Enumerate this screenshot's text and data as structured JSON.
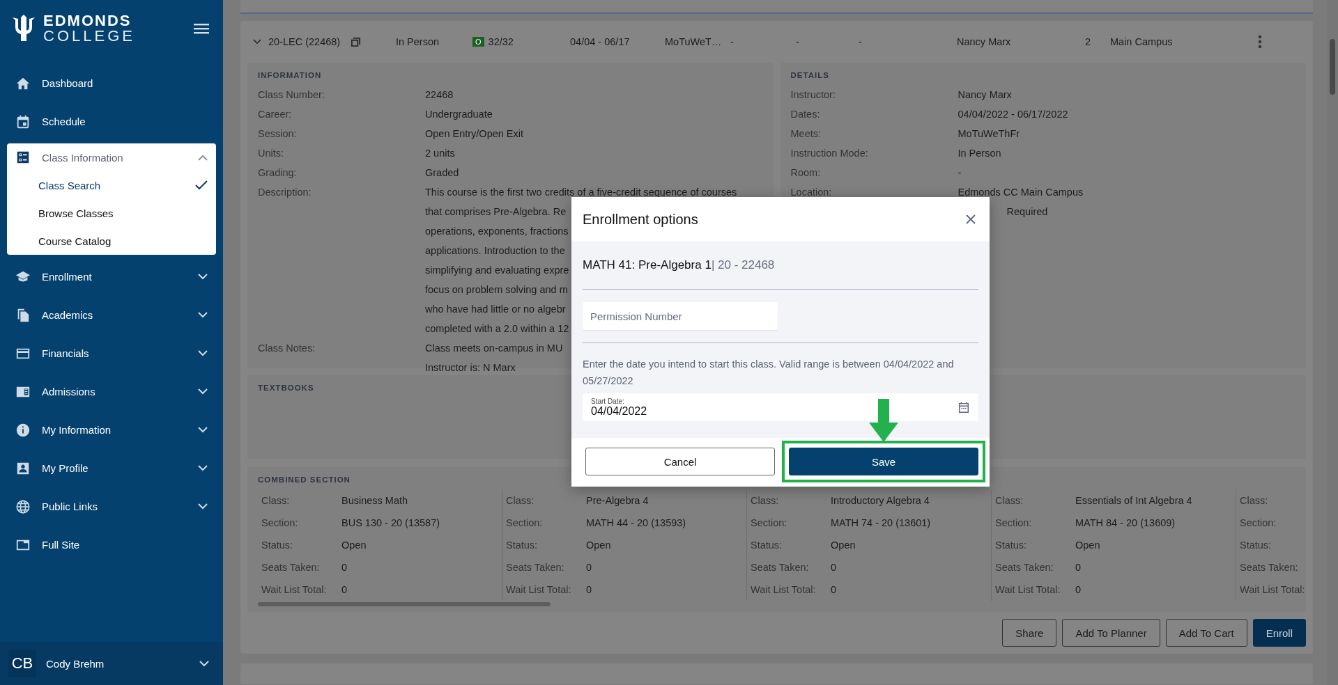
{
  "sidebar": {
    "logo": {
      "line1": "EDMONDS",
      "line2": "COLLEGE"
    },
    "items": [
      {
        "label": "Dashboard",
        "expandable": false,
        "expanded": false
      },
      {
        "label": "Schedule",
        "expandable": false,
        "expanded": false
      },
      {
        "label": "Class Information",
        "expandable": true,
        "expanded": true,
        "children": [
          {
            "label": "Class Search",
            "selected": true
          },
          {
            "label": "Browse Classes",
            "selected": false
          },
          {
            "label": "Course Catalog",
            "selected": false
          }
        ]
      },
      {
        "label": "Enrollment",
        "expandable": true,
        "expanded": false
      },
      {
        "label": "Academics",
        "expandable": true,
        "expanded": false
      },
      {
        "label": "Financials",
        "expandable": true,
        "expanded": false
      },
      {
        "label": "Admissions",
        "expandable": true,
        "expanded": false
      },
      {
        "label": "My Information",
        "expandable": true,
        "expanded": false
      },
      {
        "label": "My Profile",
        "expandable": true,
        "expanded": false
      },
      {
        "label": "Public Links",
        "expandable": true,
        "expanded": false
      },
      {
        "label": "Full Site",
        "expandable": false,
        "expanded": false
      }
    ],
    "user": {
      "initials": "CB",
      "name": "Cody Brehm"
    }
  },
  "class_row": {
    "expanded": true,
    "section": "20-LEC (22468)",
    "mode": "In Person",
    "status_badge": "O",
    "seats": "32/32",
    "dates": "04/04 - 06/17",
    "days": "MoTuWeT…",
    "column_7": "-",
    "column_8": "-",
    "column_9": "-",
    "instructor": "Nancy Marx",
    "units": "2",
    "campus": "Main Campus"
  },
  "information": {
    "title": "INFORMATION",
    "rows": [
      {
        "label": "Class Number:",
        "lines": [
          "22468"
        ]
      },
      {
        "label": "Career:",
        "lines": [
          "Undergraduate"
        ]
      },
      {
        "label": "Session:",
        "lines": [
          "Open Entry/Open Exit"
        ]
      },
      {
        "label": "Units:",
        "lines": [
          "2 units"
        ]
      },
      {
        "label": "Grading:",
        "lines": [
          "Graded"
        ]
      },
      {
        "label": "Description:",
        "lines": [
          "This course is the first two credits of a five-credit sequence of courses",
          "that comprises Pre-Algebra. Re",
          "operations, exponents, fractions",
          "applications. Introduction to the",
          "simplifying and evaluating expre",
          "focus on problem solving and m",
          "who have had little or no algebr",
          "completed with a 2.0 within a 12"
        ]
      },
      {
        "label": "Class Notes:",
        "lines": [
          "Class meets on-campus in MU",
          "Instructor is: N Marx"
        ]
      }
    ]
  },
  "details": {
    "title": "DETAILS",
    "rows": [
      {
        "label": "Instructor:",
        "value": "Nancy Marx"
      },
      {
        "label": "Dates:",
        "value": "04/04/2022 - 06/17/2022"
      },
      {
        "label": "Meets:",
        "value": "MoTuWeThFr"
      },
      {
        "label": "Instruction Mode:",
        "value": "In Person"
      },
      {
        "label": "Room:",
        "value": "-"
      },
      {
        "label": "Location:",
        "value": "Edmonds CC Main Campus"
      },
      {
        "value": "Required"
      }
    ]
  },
  "textbooks": {
    "title": "TEXTBOOKS"
  },
  "combined": {
    "title": "COMBINED SECTION",
    "columns": [
      {
        "rows": [
          {
            "label": "Class:",
            "value": "Business Math"
          },
          {
            "label": "Section:",
            "value": "BUS 130 - 20 (13587)"
          },
          {
            "label": "Status:",
            "value": "Open"
          },
          {
            "label": "Seats Taken:",
            "value": "0"
          },
          {
            "label": "Wait List Total:",
            "value": "0"
          }
        ]
      },
      {
        "rows": [
          {
            "label": "Class:",
            "value": "Pre-Algebra 4"
          },
          {
            "label": "Section:",
            "value": "MATH 44 - 20 (13593)"
          },
          {
            "label": "Status:",
            "value": "Open"
          },
          {
            "label": "Seats Taken:",
            "value": "0"
          },
          {
            "label": "Wait List Total:",
            "value": "0"
          }
        ]
      },
      {
        "rows": [
          {
            "label": "Class:",
            "value": "Introductory Algebra 4"
          },
          {
            "label": "Section:",
            "value": "MATH 74 - 20 (13601)"
          },
          {
            "label": "Status:",
            "value": "Open"
          },
          {
            "label": "Seats Taken:",
            "value": "0"
          },
          {
            "label": "Wait List Total:",
            "value": "0"
          }
        ]
      },
      {
        "rows": [
          {
            "label": "Class:",
            "value": "Essentials of Int Algebra 4"
          },
          {
            "label": "Section:",
            "value": "MATH 84 - 20 (13609)"
          },
          {
            "label": "Status:",
            "value": "Open"
          },
          {
            "label": "Seats Taken:",
            "value": "0"
          },
          {
            "label": "Wait List Total:",
            "value": "0"
          }
        ]
      },
      {
        "rows": [
          {
            "label": "Class:"
          },
          {
            "label": "Section:"
          },
          {
            "label": "Status:"
          },
          {
            "label": "Seats Taken:"
          },
          {
            "label": "Wait List Total:"
          }
        ]
      }
    ]
  },
  "actions": [
    {
      "label": "Share",
      "primary": false
    },
    {
      "label": "Add To Planner",
      "primary": false
    },
    {
      "label": "Add To Cart",
      "primary": false
    },
    {
      "label": "Enroll",
      "primary": true
    }
  ],
  "modal": {
    "title": "Enrollment options",
    "course": "MATH 41: Pre-Algebra 1",
    "section": "| 20 - 22468",
    "permission_placeholder": "Permission Number",
    "hint": "Enter the date you intend to start this class. Valid range is between 04/04/2022 and 05/27/2022",
    "start_date": {
      "label": "Start Date:",
      "value": "04/04/2022"
    },
    "buttons": [
      {
        "label": "Cancel",
        "primary": false,
        "highlighted": false
      },
      {
        "label": "Save",
        "primary": true,
        "highlighted": true
      }
    ]
  }
}
